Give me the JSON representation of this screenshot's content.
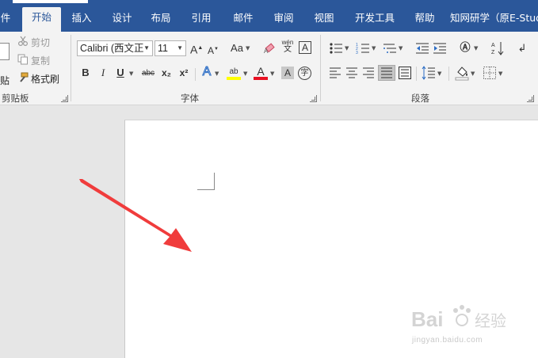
{
  "tabs": [
    {
      "label": "件"
    },
    {
      "label": "开始"
    },
    {
      "label": "插入"
    },
    {
      "label": "设计"
    },
    {
      "label": "布局"
    },
    {
      "label": "引用"
    },
    {
      "label": "邮件"
    },
    {
      "label": "审阅"
    },
    {
      "label": "视图"
    },
    {
      "label": "开发工具"
    },
    {
      "label": "帮助"
    },
    {
      "label": "知网研学（原E-Stud"
    }
  ],
  "clipboard": {
    "paste_label": "贴",
    "cut_label": "剪切",
    "copy_label": "复制",
    "format_painter_label": "格式刷",
    "group_label": "剪贴板"
  },
  "font": {
    "font_name": "Calibri (西文正",
    "font_size": "11",
    "change_case_label": "Aa",
    "phonetic_top": "wén",
    "phonetic_bottom": "文",
    "bold": "B",
    "italic": "I",
    "underline": "U",
    "strikethrough": "abc",
    "subscript": "x₂",
    "superscript": "x²",
    "enclose_char": "字",
    "group_label": "字体",
    "highlight_color": "#ffff00",
    "font_color": "#e81123"
  },
  "paragraph": {
    "group_label": "段落"
  },
  "colors": {
    "tab_bar": "#2b579a",
    "ribbon": "#f3f3f3",
    "annotation_arrow": "#f03c3c"
  },
  "watermark": {
    "brand": "Bai 经验",
    "url": "jingyan.baidu.com"
  }
}
